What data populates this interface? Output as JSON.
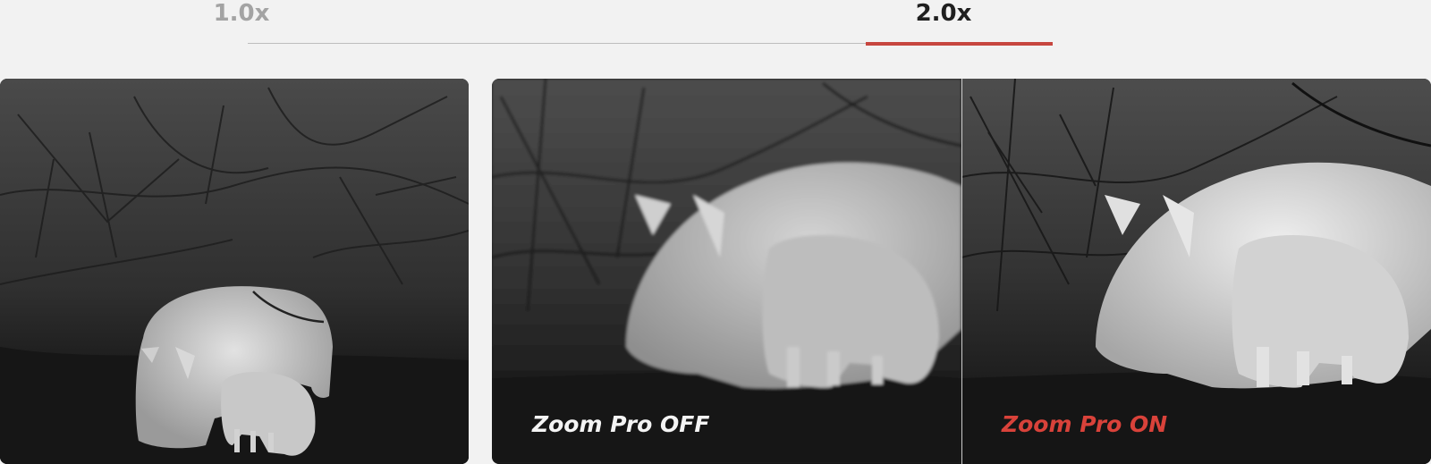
{
  "zoom_tabs": [
    {
      "label": "1.0x",
      "selected": false
    },
    {
      "label": "2.0x",
      "selected": true
    }
  ],
  "colors": {
    "accent": "#c7463f",
    "caption_off": "#f4f4f4",
    "caption_on": "#d9423a",
    "tab_inactive": "#a3a3a3",
    "tab_active": "#1f1f1f",
    "background": "#f2f2f2"
  },
  "comparison": {
    "off_label": "Zoom Pro OFF",
    "on_label": "Zoom Pro ON"
  }
}
